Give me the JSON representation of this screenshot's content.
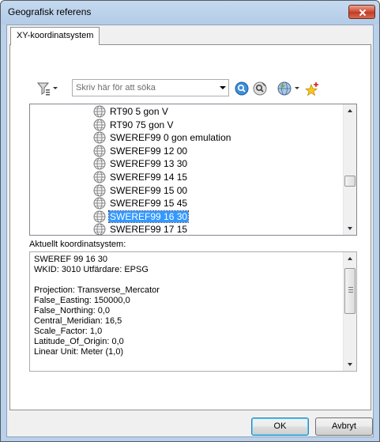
{
  "window": {
    "title": "Geografisk referens"
  },
  "tabs": [
    {
      "label": "XY-koordinatsystem"
    }
  ],
  "toolbar": {
    "search_placeholder": "Skriv här för att söka",
    "icons": [
      "filter-icon",
      "search-icon",
      "clear-search-icon",
      "globe-icon",
      "add-favorite-icon"
    ]
  },
  "tree": {
    "items": [
      {
        "label": "RT90 5 gon V",
        "selected": false
      },
      {
        "label": "RT90 75 gon V",
        "selected": false
      },
      {
        "label": "SWEREF99 0 gon emulation",
        "selected": false
      },
      {
        "label": "SWEREF99 12 00",
        "selected": false
      },
      {
        "label": "SWEREF99 13 30",
        "selected": false
      },
      {
        "label": "SWEREF99 14 15",
        "selected": false
      },
      {
        "label": "SWEREF99 15 00",
        "selected": false
      },
      {
        "label": "SWEREF99 15 45",
        "selected": false
      },
      {
        "label": "SWEREF99 16 30",
        "selected": true
      },
      {
        "label": "SWEREF99 17 15",
        "selected": false
      }
    ],
    "scroll_fraction": 0.62
  },
  "current": {
    "label": "Aktuellt koordinatsystem:",
    "lines": [
      "SWEREF 99 16 30",
      "WKID: 3010 Utfärdare: EPSG",
      "",
      "Projection: Transverse_Mercator",
      "False_Easting: 150000,0",
      "False_Northing: 0,0",
      "Central_Meridian: 16,5",
      "Scale_Factor: 1,0",
      "Latitude_Of_Origin: 0,0",
      "Linear Unit: Meter (1,0)"
    ]
  },
  "buttons": {
    "ok": "OK",
    "cancel": "Avbryt"
  },
  "colors": {
    "selection": "#3399ff",
    "frame": "#b9d1ea"
  }
}
